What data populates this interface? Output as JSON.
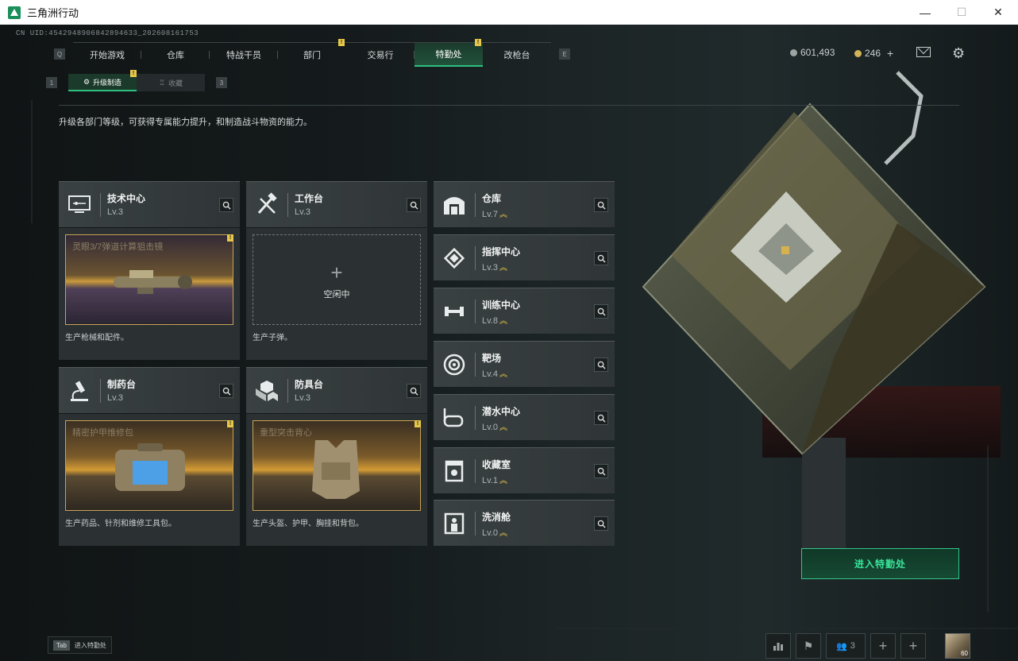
{
  "window": {
    "title": "三角洲行动"
  },
  "uid": "CN UID:4542948906842894633_202608161753",
  "nav": {
    "left_key": "Q",
    "right_key": "E",
    "tabs": [
      "开始游戏",
      "仓库",
      "特战干员",
      "部门",
      "交易行",
      "特勤处",
      "改枪台"
    ],
    "active": "特勤处"
  },
  "subnav": {
    "left_key": "1",
    "right_key": "3",
    "tabs": [
      "升级制造",
      "收藏"
    ],
    "active": "升级制造"
  },
  "hint": "升级各部门等级，可获得专属能力提升，和制造战斗物资的能力。",
  "currency": {
    "silver": "601,493",
    "gold": "246",
    "plus": "+"
  },
  "badge_mark": "!",
  "cards": [
    {
      "name": "技术中心",
      "level": "Lv.3",
      "product": "灵眼3/7弹道计算狙击镜",
      "desc": "生产枪械和配件。"
    },
    {
      "name": "工作台",
      "level": "Lv.3",
      "idle_plus": "+",
      "idle": "空闲中",
      "desc": "生产子弹。"
    },
    {
      "name": "制药台",
      "level": "Lv.3",
      "product": "精密护甲维修包",
      "desc": "生产药品、针剂和维修工具包。"
    },
    {
      "name": "防具台",
      "level": "Lv.3",
      "product": "重型突击背心",
      "desc": "生产头盔、护甲、胸挂和背包。"
    }
  ],
  "facilities": [
    {
      "name": "仓库",
      "level": "Lv.7",
      "upgrade": "︽"
    },
    {
      "name": "指挥中心",
      "level": "Lv.3",
      "upgrade": "︽"
    },
    {
      "name": "训练中心",
      "level": "Lv.8",
      "upgrade": "︽"
    },
    {
      "name": "靶场",
      "level": "Lv.4",
      "upgrade": "︽"
    },
    {
      "name": "潜水中心",
      "level": "Lv.0",
      "upgrade": "︽"
    },
    {
      "name": "收藏室",
      "level": "Lv.1",
      "upgrade": "︽"
    },
    {
      "name": "洗消舱",
      "level": "Lv.0",
      "upgrade": "︽"
    }
  ],
  "enter_button": "进入特勤处",
  "tab_hint": {
    "key": "Tab",
    "text": "进入特勤处"
  },
  "bottom": {
    "squad_count": "3",
    "avatar_level": "60"
  },
  "colors": {
    "accent": "#2fc080",
    "gold": "#e8c84a",
    "panel": "#3a4142"
  }
}
